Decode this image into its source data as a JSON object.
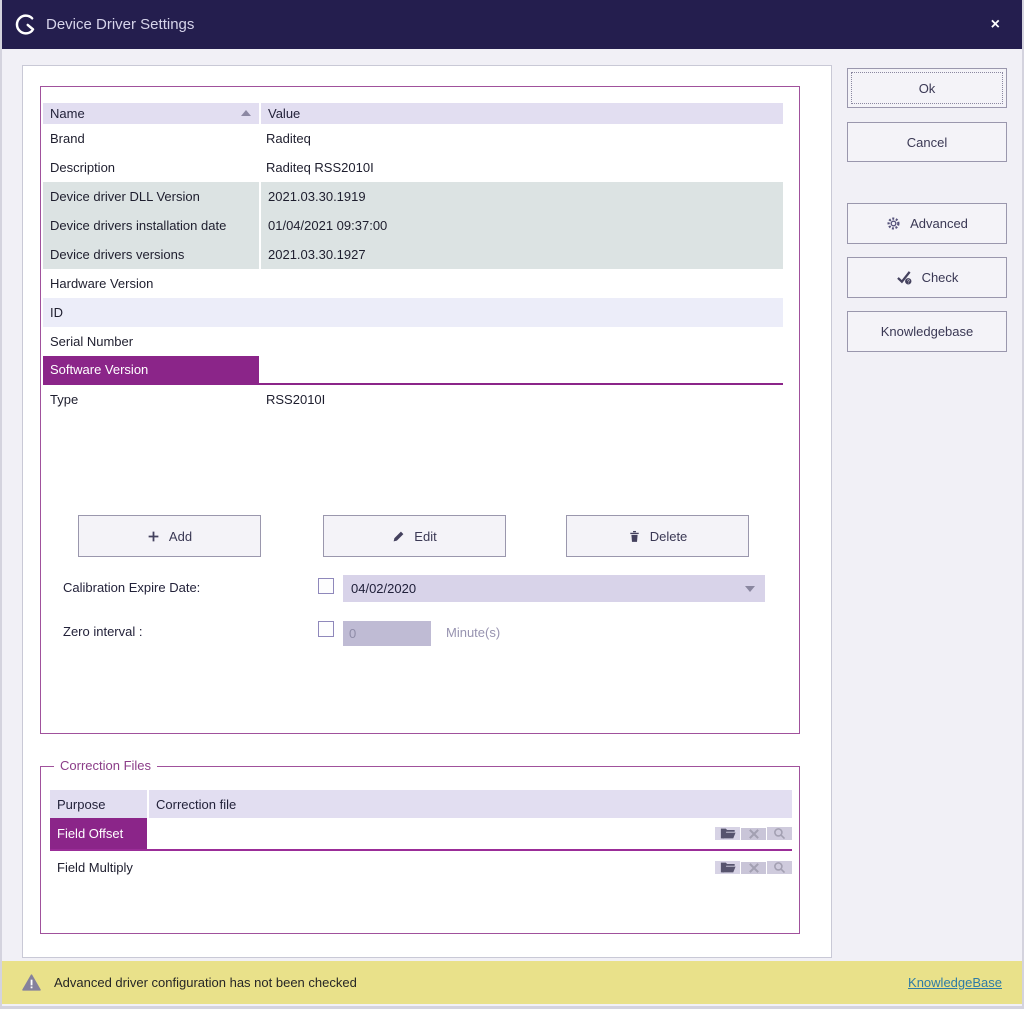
{
  "window": {
    "title": "Device Driver Settings",
    "close": "×"
  },
  "colors": {
    "titlebar": "#241e4e",
    "accent_purple": "#a0519c",
    "selected_purple": "#8b2589",
    "status_yellow": "#e9e18a",
    "link_blue": "#2e7ba6"
  },
  "properties": {
    "columns": {
      "name": "Name",
      "value": "Value"
    },
    "rows": [
      {
        "name": "Brand",
        "value": "Raditeq"
      },
      {
        "name": "Description",
        "value": "Raditeq RSS2010I"
      },
      {
        "name": "Device driver DLL Version",
        "value": "2021.03.30.1919"
      },
      {
        "name": "Device drivers installation date",
        "value": "01/04/2021 09:37:00"
      },
      {
        "name": "Device drivers versions",
        "value": "2021.03.30.1927"
      },
      {
        "name": "Hardware Version",
        "value": ""
      },
      {
        "name": "ID",
        "value": ""
      },
      {
        "name": "Serial Number",
        "value": ""
      },
      {
        "name": "Software Version",
        "value": ""
      },
      {
        "name": "Type",
        "value": "RSS2010I"
      }
    ]
  },
  "actions": {
    "add": "Add",
    "edit": "Edit",
    "delete": "Delete"
  },
  "calibration": {
    "label": "Calibration Expire Date:",
    "date": "04/02/2020",
    "checked": false
  },
  "zero_interval": {
    "label": "Zero interval :",
    "value": "0",
    "unit": "Minute(s)",
    "checked": false
  },
  "correction_files": {
    "group_label": "Correction Files",
    "columns": {
      "purpose": "Purpose",
      "file": "Correction file"
    },
    "rows": [
      {
        "purpose": "Field Offset",
        "file": ""
      },
      {
        "purpose": "Field Multiply",
        "file": ""
      }
    ]
  },
  "side_buttons": {
    "ok": "Ok",
    "cancel": "Cancel",
    "advanced": "Advanced",
    "check": "Check",
    "knowledgebase": "Knowledgebase"
  },
  "status_bar": {
    "message": "Advanced driver configuration has not been checked",
    "link": "KnowledgeBase"
  }
}
